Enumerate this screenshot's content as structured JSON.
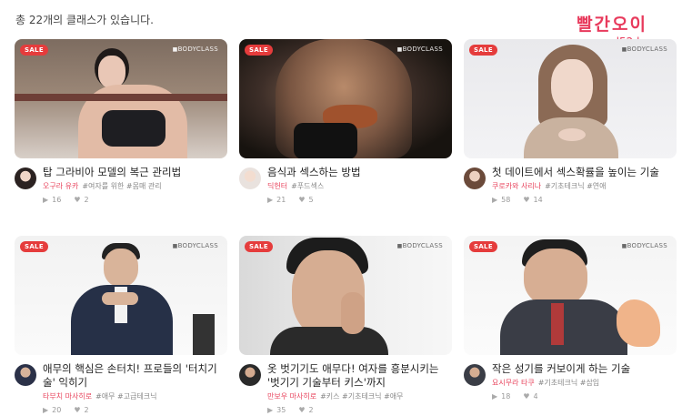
{
  "header": {
    "count_text": "총 22개의 클래스가 있습니다."
  },
  "watermark": {
    "line1": "빨간오이",
    "line2": "red52.kr"
  },
  "cards": [
    {
      "sale": "SALE",
      "brand": "BODYCLASS",
      "title": "탑 그라비아 모델의 복근 관리법",
      "author": "오구라 유카",
      "tags": "#여자를 위한 #몸매 관리",
      "views": "16",
      "likes": "2"
    },
    {
      "sale": "SALE",
      "brand": "BODYCLASS",
      "title": "음식과 섹스하는 방법",
      "author": "딕헌터",
      "tags": "#푸드섹스",
      "views": "21",
      "likes": "5"
    },
    {
      "sale": "SALE",
      "brand": "BODYCLASS",
      "title": "첫 데이트에서 섹스확률을 높이는 기술",
      "author": "쿠로카와 사리나",
      "tags": "#기초테크닉 #연애",
      "views": "58",
      "likes": "14"
    },
    {
      "sale": "SALE",
      "brand": "BODYCLASS",
      "title": "애무의 핵심은 손터치! 프로들의 '터치기술' 익히기",
      "author": "타부치 마사히로",
      "tags": "#애무 #고급테크닉",
      "views": "20",
      "likes": "2"
    },
    {
      "sale": "SALE",
      "brand": "BODYCLASS",
      "title": "옷 벗기기도 애무다! 여자를 흥분시키는 '벗기기 기술부터 키스'까지",
      "author": "만보우 마사히로",
      "tags": "#키스 #기초테크닉 #애무",
      "views": "35",
      "likes": "2"
    },
    {
      "sale": "SALE",
      "brand": "BODYCLASS",
      "title": "작은 성기를 커보이게 하는 기술",
      "author": "요시무라 타쿠",
      "tags": "#기초테크닉 #삽입",
      "views": "18",
      "likes": "4"
    }
  ],
  "colors": {
    "accent": "#e8455e",
    "sale_badge": "#e53c3c"
  },
  "icons": {
    "views": "play-icon",
    "likes": "heart-icon"
  }
}
